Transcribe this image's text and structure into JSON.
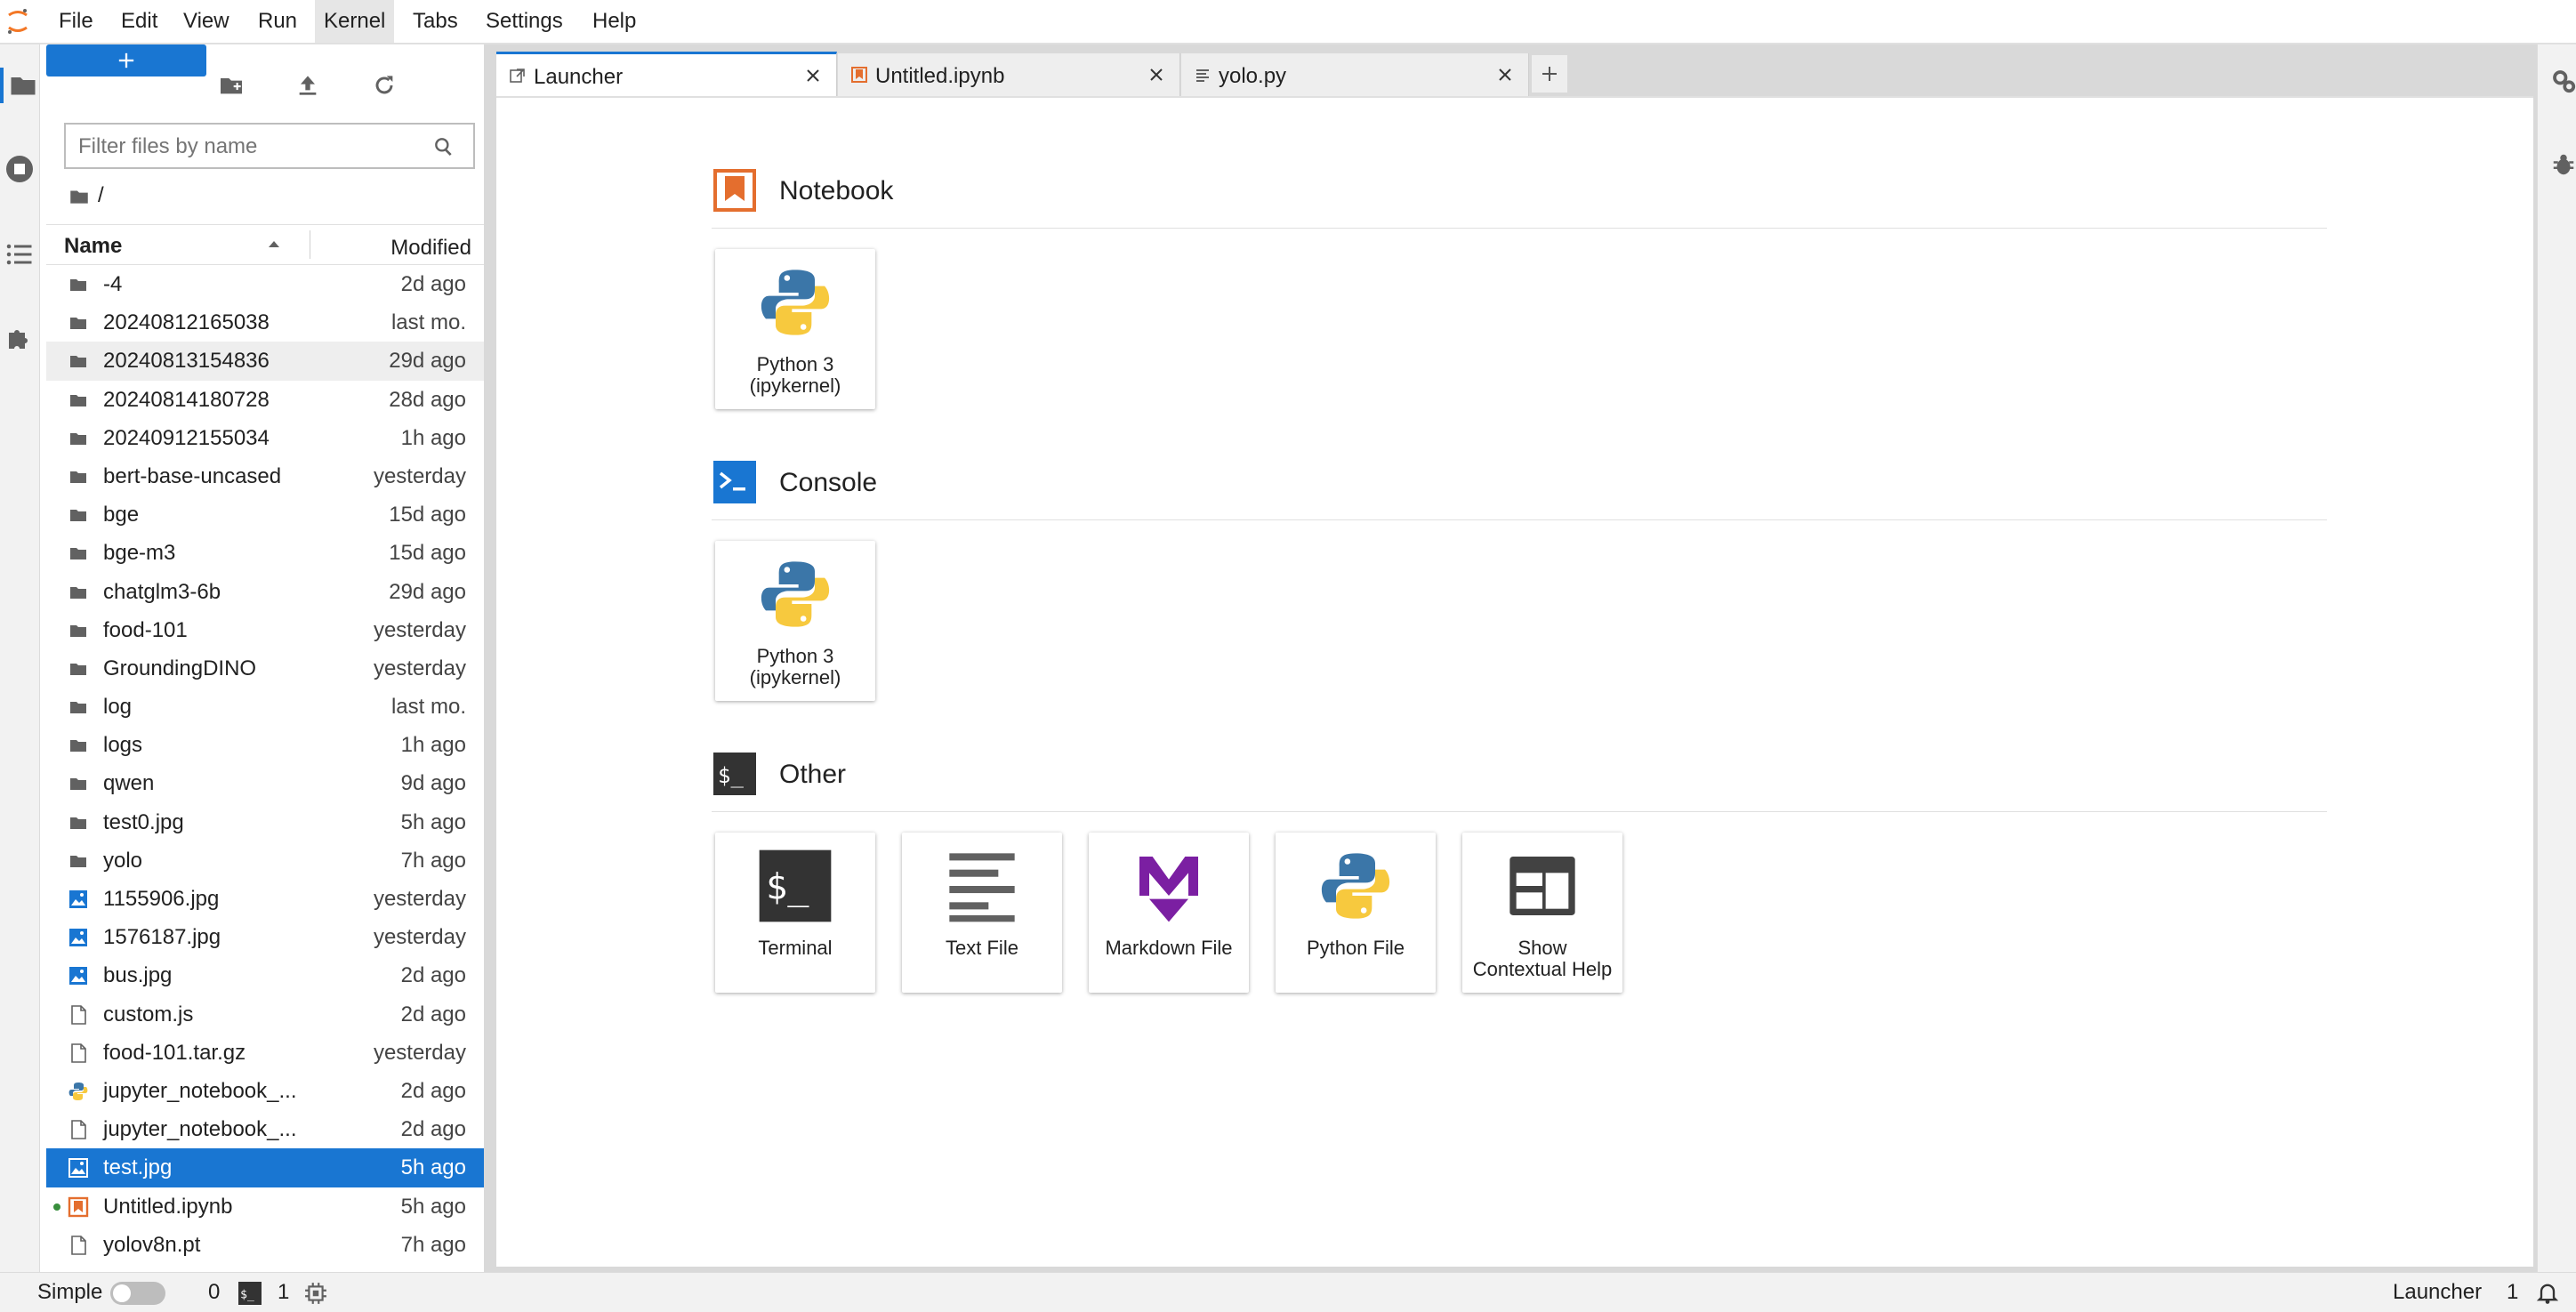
{
  "menu": [
    "File",
    "Edit",
    "View",
    "Run",
    "Kernel",
    "Tabs",
    "Settings",
    "Help"
  ],
  "filebrowser": {
    "filter_placeholder": "Filter files by name",
    "breadcrumb": "/",
    "col_name": "Name",
    "col_modified": "Modified",
    "files": [
      {
        "name": "-4",
        "modified": "2d ago",
        "type": "folder"
      },
      {
        "name": "20240812165038",
        "modified": "last mo.",
        "type": "folder"
      },
      {
        "name": "20240813154836",
        "modified": "29d ago",
        "type": "folder"
      },
      {
        "name": "20240814180728",
        "modified": "28d ago",
        "type": "folder"
      },
      {
        "name": "20240912155034",
        "modified": "1h ago",
        "type": "folder"
      },
      {
        "name": "bert-base-uncased",
        "modified": "yesterday",
        "type": "folder"
      },
      {
        "name": "bge",
        "modified": "15d ago",
        "type": "folder"
      },
      {
        "name": "bge-m3",
        "modified": "15d ago",
        "type": "folder"
      },
      {
        "name": "chatglm3-6b",
        "modified": "29d ago",
        "type": "folder"
      },
      {
        "name": "food-101",
        "modified": "yesterday",
        "type": "folder"
      },
      {
        "name": "GroundingDINO",
        "modified": "yesterday",
        "type": "folder"
      },
      {
        "name": "log",
        "modified": "last mo.",
        "type": "folder"
      },
      {
        "name": "logs",
        "modified": "1h ago",
        "type": "folder"
      },
      {
        "name": "qwen",
        "modified": "9d ago",
        "type": "folder"
      },
      {
        "name": "test0.jpg",
        "modified": "5h ago",
        "type": "folder"
      },
      {
        "name": "yolo",
        "modified": "7h ago",
        "type": "folder"
      },
      {
        "name": "1155906.jpg",
        "modified": "yesterday",
        "type": "image"
      },
      {
        "name": "1576187.jpg",
        "modified": "yesterday",
        "type": "image"
      },
      {
        "name": "bus.jpg",
        "modified": "2d ago",
        "type": "image"
      },
      {
        "name": "custom.js",
        "modified": "2d ago",
        "type": "file"
      },
      {
        "name": "food-101.tar.gz",
        "modified": "yesterday",
        "type": "file"
      },
      {
        "name": "jupyter_notebook_...",
        "modified": "2d ago",
        "type": "python"
      },
      {
        "name": "jupyter_notebook_...",
        "modified": "2d ago",
        "type": "file"
      },
      {
        "name": "test.jpg",
        "modified": "5h ago",
        "type": "image"
      },
      {
        "name": "Untitled.ipynb",
        "modified": "5h ago",
        "type": "notebook"
      },
      {
        "name": "yolov8n.pt",
        "modified": "7h ago",
        "type": "file"
      }
    ]
  },
  "tabs": [
    {
      "label": "Launcher"
    },
    {
      "label": "Untitled.ipynb"
    },
    {
      "label": "yolo.py"
    }
  ],
  "launcher": {
    "notebook_title": "Notebook",
    "console_title": "Console",
    "other_title": "Other",
    "notebook_cards": [
      "Python 3\n(ipykernel)"
    ],
    "console_cards": [
      "Python 3\n(ipykernel)"
    ],
    "other_cards": [
      "Terminal",
      "Text File",
      "Markdown File",
      "Python File",
      "Show\nContextual Help"
    ]
  },
  "status": {
    "mode_label": "Simple",
    "terminals_count": "0",
    "kernels_count": "1",
    "right_label": "Launcher",
    "right_count": "1"
  },
  "colors": {
    "accent": "#1976d2",
    "notebook_orange": "#e46e2e",
    "markdown_purple": "#7b1fa2"
  }
}
